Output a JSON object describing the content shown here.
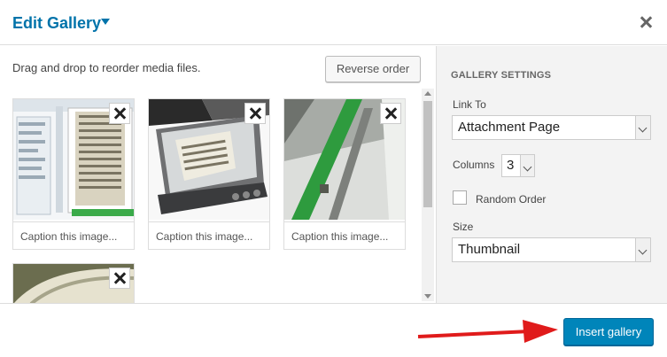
{
  "header": {
    "title": "Edit Gallery"
  },
  "main": {
    "instructions": "Drag and drop to reorder media files.",
    "reverse_label": "Reverse order",
    "caption_placeholder": "Caption this image..."
  },
  "sidebar": {
    "title": "GALLERY SETTINGS",
    "link_to_label": "Link To",
    "link_to_value": "Attachment Page",
    "columns_label": "Columns",
    "columns_value": "3",
    "random_label": "Random Order",
    "size_label": "Size",
    "size_value": "Thumbnail"
  },
  "footer": {
    "insert_label": "Insert gallery"
  },
  "colors": {
    "accent": "#0073aa",
    "button": "#0085ba",
    "annotation_arrow": "#e01b1b"
  },
  "icons": [
    "close-icon",
    "dropdown-caret-icon",
    "remove-icon",
    "scroll-arrow-icon",
    "chevron-down-icon"
  ]
}
